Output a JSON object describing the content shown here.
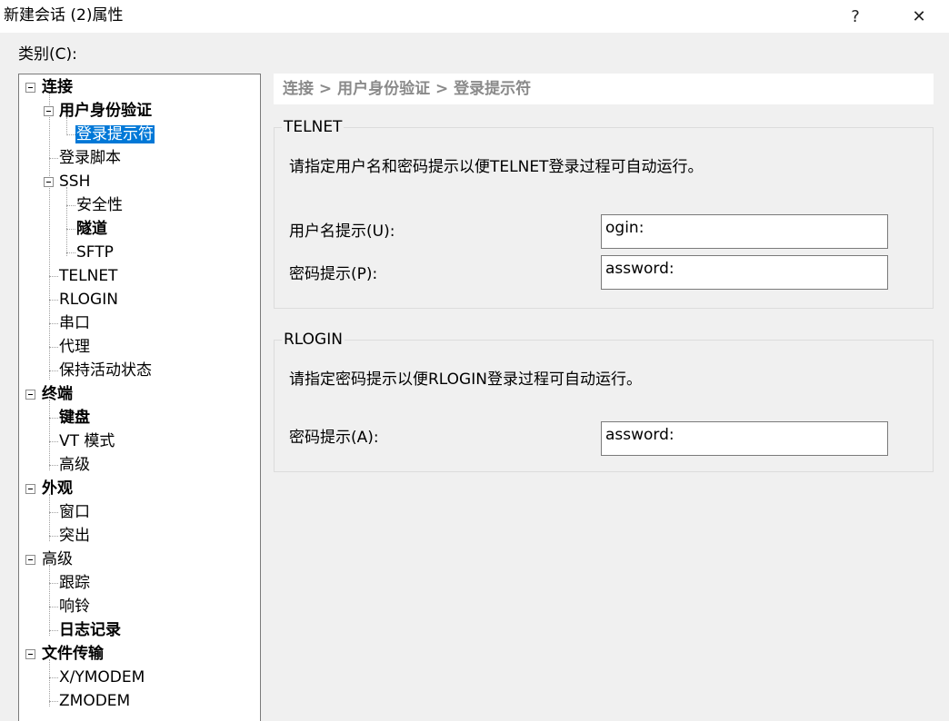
{
  "window": {
    "title": "新建会话 (2)属性",
    "help_glyph": "?",
    "close_glyph": "✕"
  },
  "category_label": "类别(C):",
  "tree": {
    "items": [
      {
        "label": "连接",
        "bold": true
      },
      {
        "label": "用户身份验证",
        "bold": true
      },
      {
        "label": "登录提示符",
        "bold": false,
        "selected": true
      },
      {
        "label": "登录脚本",
        "bold": false
      },
      {
        "label": "SSH",
        "bold": false
      },
      {
        "label": "安全性",
        "bold": false
      },
      {
        "label": "隧道",
        "bold": true
      },
      {
        "label": "SFTP",
        "bold": false
      },
      {
        "label": "TELNET",
        "bold": false
      },
      {
        "label": "RLOGIN",
        "bold": false
      },
      {
        "label": "串口",
        "bold": false
      },
      {
        "label": "代理",
        "bold": false
      },
      {
        "label": "保持活动状态",
        "bold": false
      },
      {
        "label": "终端",
        "bold": true
      },
      {
        "label": "键盘",
        "bold": true
      },
      {
        "label": "VT 模式",
        "bold": false
      },
      {
        "label": "高级",
        "bold": false
      },
      {
        "label": "外观",
        "bold": true
      },
      {
        "label": "窗口",
        "bold": false
      },
      {
        "label": "突出",
        "bold": false
      },
      {
        "label": "高级",
        "bold": false
      },
      {
        "label": "跟踪",
        "bold": false
      },
      {
        "label": "响铃",
        "bold": false
      },
      {
        "label": "日志记录",
        "bold": true
      },
      {
        "label": "文件传输",
        "bold": true
      },
      {
        "label": "X/YMODEM",
        "bold": false
      },
      {
        "label": "ZMODEM",
        "bold": false
      }
    ]
  },
  "breadcrumb": "连接 > 用户身份验证 > 登录提示符",
  "telnet": {
    "title": "TELNET",
    "description": "请指定用户名和密码提示以便TELNET登录过程可自动运行。",
    "username_label": "用户名提示(U):",
    "username_value": "ogin:",
    "password_label": "密码提示(P):",
    "password_value": "assword:"
  },
  "rlogin": {
    "title": "RLOGIN",
    "description": "请指定密码提示以便RLOGIN登录过程可自动运行。",
    "password_label": "密码提示(A):",
    "password_value": "assword:"
  }
}
